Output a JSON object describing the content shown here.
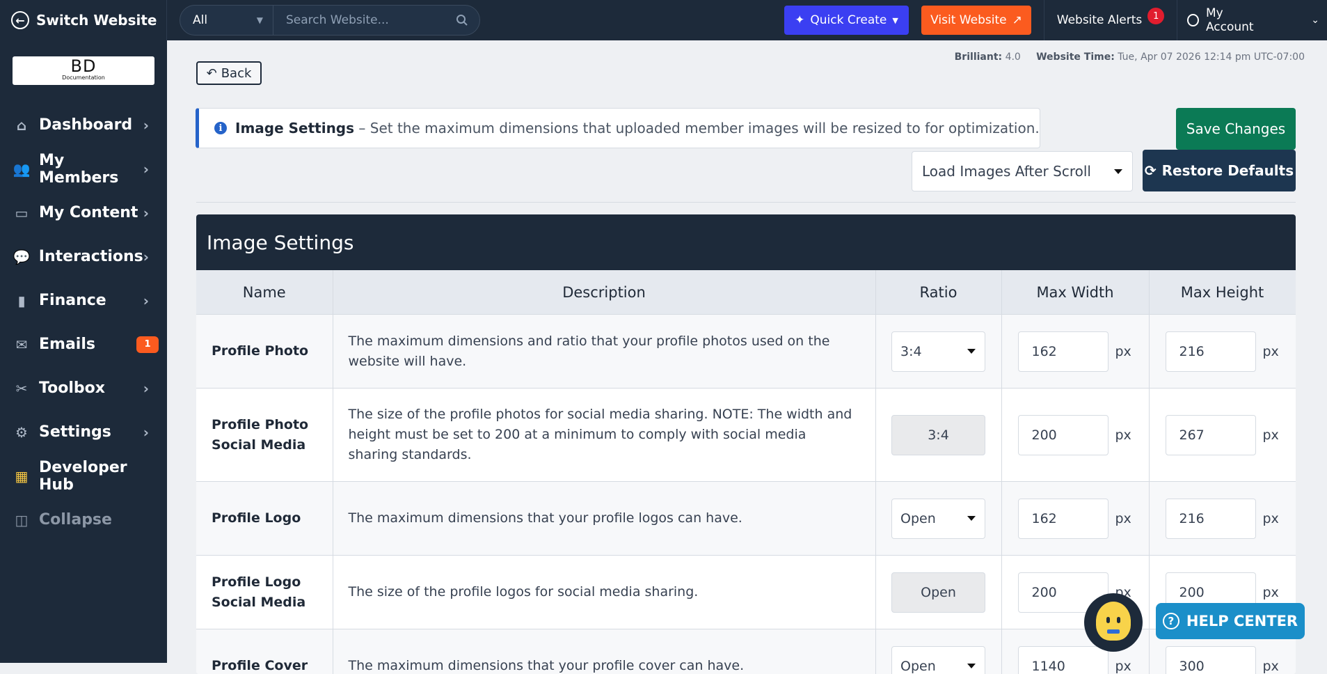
{
  "topbar": {
    "switch_label": "Switch Website",
    "scope": "All",
    "search_placeholder": "Search Website...",
    "quick_create": "Quick Create",
    "visit_website": "Visit Website",
    "alerts_label": "Website Alerts",
    "alerts_count": "1",
    "account_label": "My Account"
  },
  "brand": {
    "logo_text": "BD",
    "logo_sub": "Documentation"
  },
  "sidebar": {
    "items": [
      {
        "label": "Dashboard",
        "icon": "home-icon"
      },
      {
        "label": "My Members",
        "icon": "users-icon"
      },
      {
        "label": "My Content",
        "icon": "folder-icon"
      },
      {
        "label": "Interactions",
        "icon": "chat-icon"
      },
      {
        "label": "Finance",
        "icon": "chart-icon"
      },
      {
        "label": "Emails",
        "icon": "mail-icon",
        "badge": "1"
      },
      {
        "label": "Toolbox",
        "icon": "tools-icon"
      },
      {
        "label": "Settings",
        "icon": "gear-icon"
      },
      {
        "label": "Developer Hub",
        "icon": "grid-icon"
      },
      {
        "label": "Collapse",
        "icon": "sidebar-icon"
      }
    ]
  },
  "meta": {
    "version_label": "Brilliant:",
    "version": "4.0",
    "time_label": "Website Time:",
    "time": "Tue, Apr 07 2026 12:14 pm UTC-07:00"
  },
  "page": {
    "back": "Back",
    "alert_title": "Image Settings",
    "alert_text": "– Set the maximum dimensions that uploaded member images will be resized to for optimization.",
    "save": "Save Changes",
    "load_select": "Load Images After Scroll",
    "restore": "Restore Defaults",
    "panel_title": "Image Settings"
  },
  "table": {
    "headers": [
      "Name",
      "Description",
      "Ratio",
      "Max Width",
      "Max Height"
    ],
    "unit": "px",
    "rows": [
      {
        "name": "Profile Photo",
        "desc": "The maximum dimensions and ratio that your profile photos used on the website will have.",
        "ratio": "3:4",
        "width": "162",
        "height": "216"
      },
      {
        "name": "Profile Photo Social Media",
        "desc": "The size of the profile photos for social media sharing. NOTE: The width and height must be set to 200 at a minimum to comply with social media sharing standards.",
        "ratio": "3:4",
        "width": "200",
        "height": "267"
      },
      {
        "name": "Profile Logo",
        "desc": "The maximum dimensions that your profile logos can have.",
        "ratio": "Open",
        "width": "162",
        "height": "216"
      },
      {
        "name": "Profile Logo Social Media",
        "desc": "The size of the profile logos for social media sharing.",
        "ratio": "Open",
        "width": "200",
        "height": "200"
      },
      {
        "name": "Profile Cover",
        "desc": "The maximum dimensions that your profile cover can have.",
        "ratio": "Open",
        "width": "1140",
        "height": "300"
      }
    ]
  },
  "help": {
    "label": "HELP CENTER"
  },
  "colors": {
    "navy": "#1d2a3a",
    "quick": "#3b3ff2",
    "visit": "#fb5b1f",
    "save": "#0b7a55",
    "info": "#2563c9",
    "help": "#1b8fc9"
  }
}
